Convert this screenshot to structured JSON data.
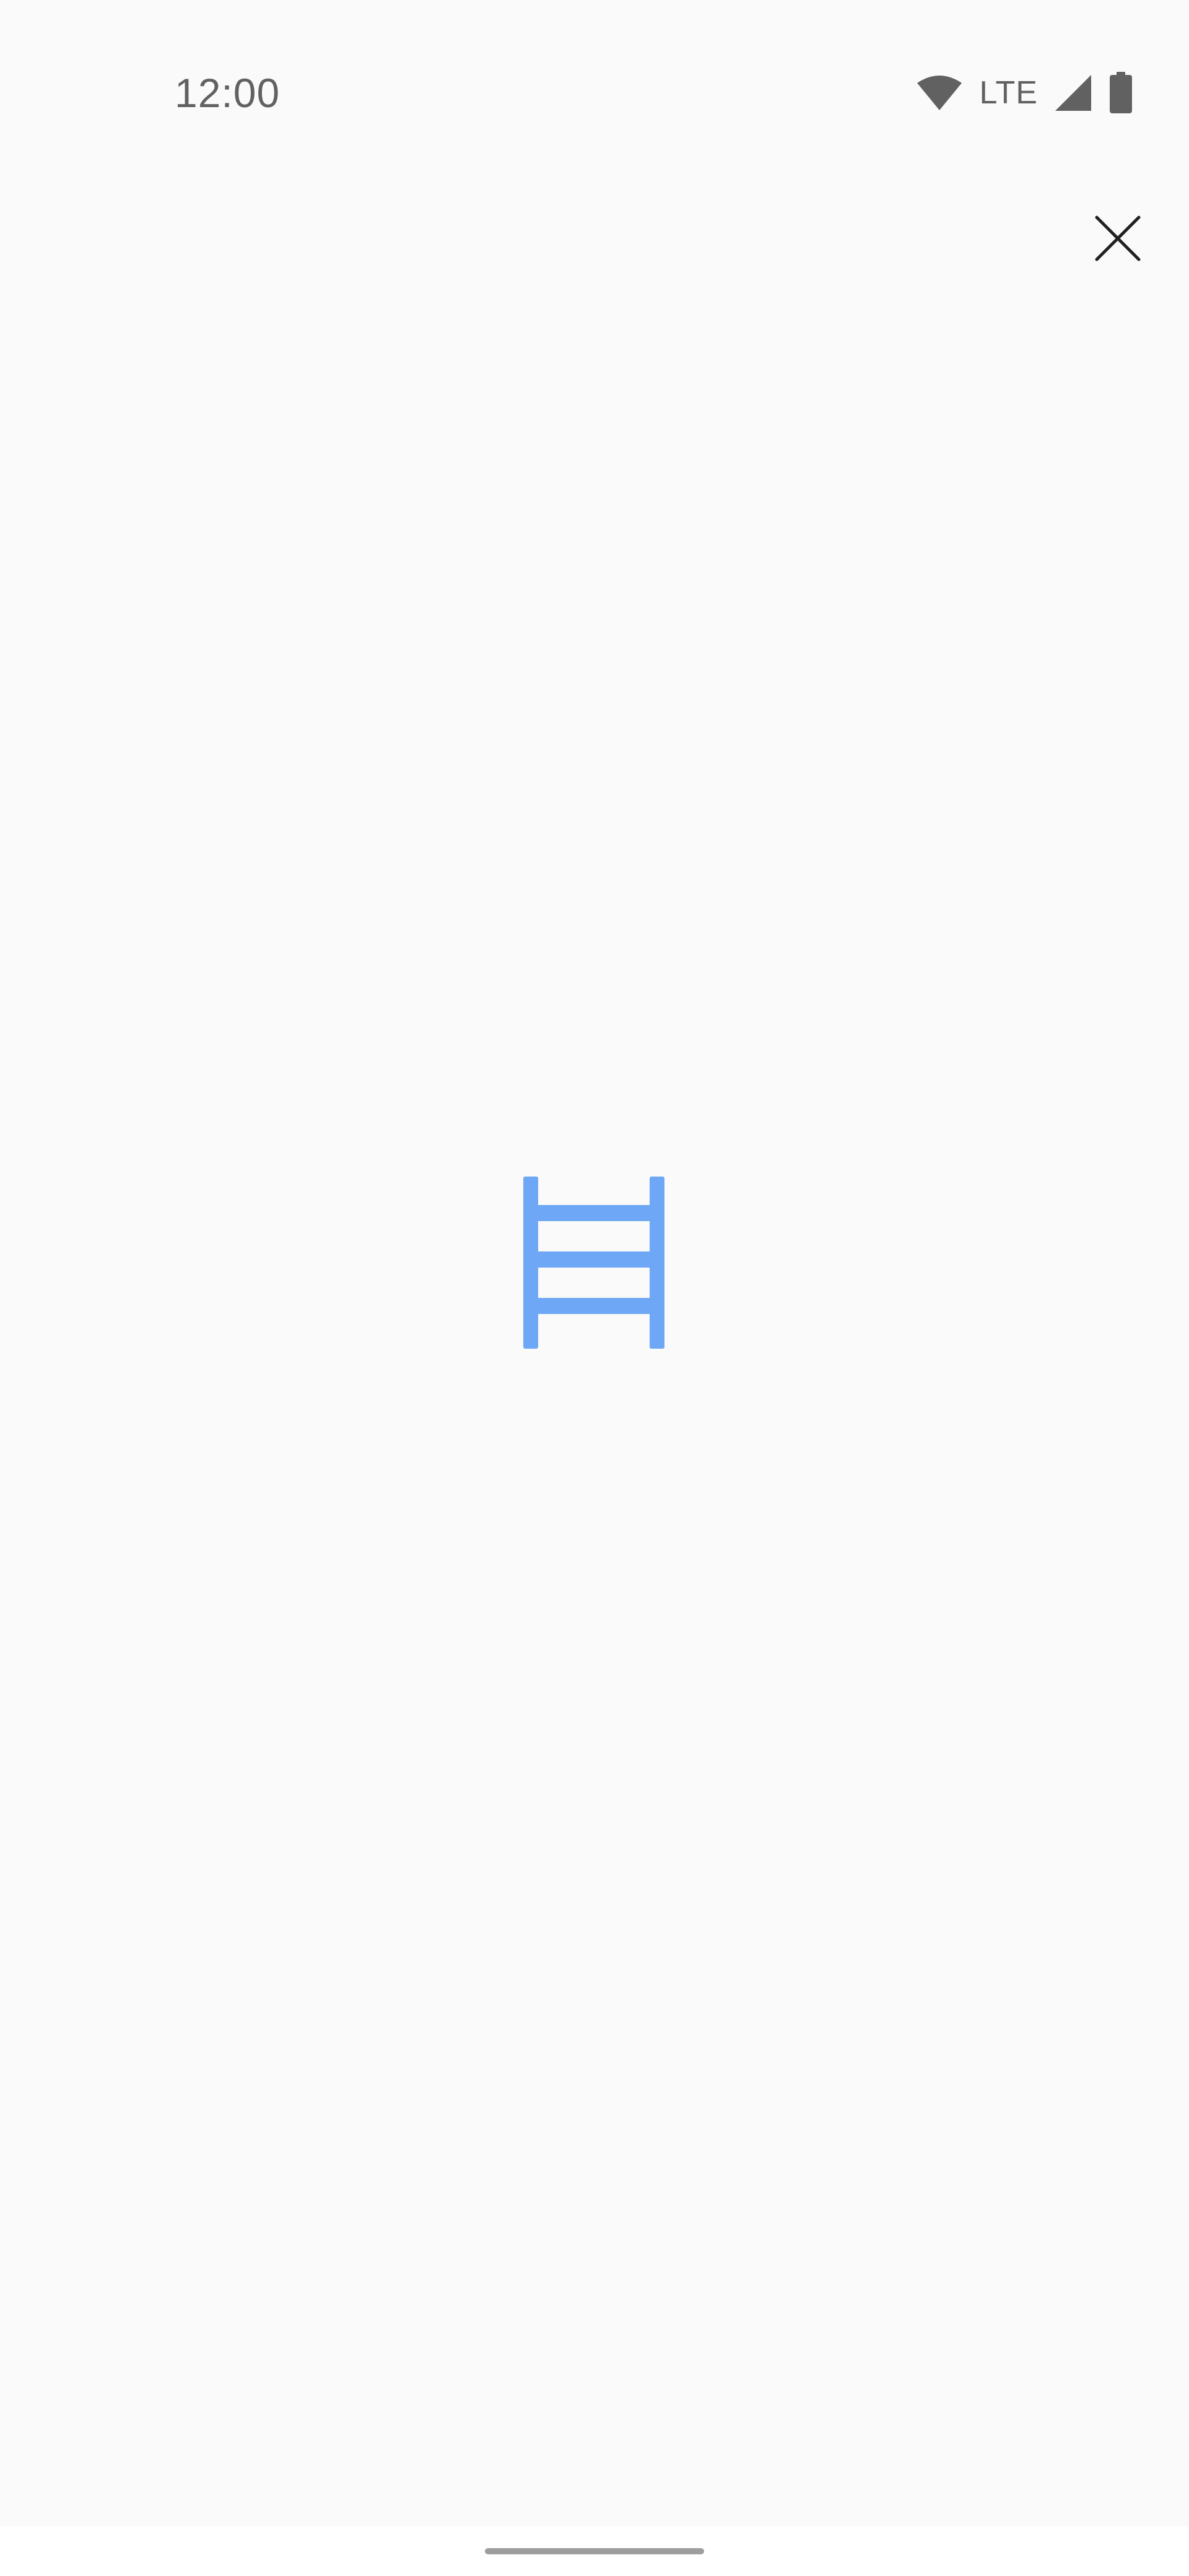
{
  "status_bar": {
    "time": "12:00",
    "network_label": "LTE",
    "icons": [
      "wifi-icon",
      "cell-signal-icon",
      "battery-icon"
    ]
  },
  "toolbar": {
    "close_icon": "close-icon"
  },
  "content": {
    "center_icon": "ladder-icon",
    "accent_color": "#6ea7f5"
  },
  "colors": {
    "background": "#fafafa",
    "status_icons": "#616161",
    "close_icon": "#212121",
    "gesture_handle": "#9e9e9e"
  }
}
